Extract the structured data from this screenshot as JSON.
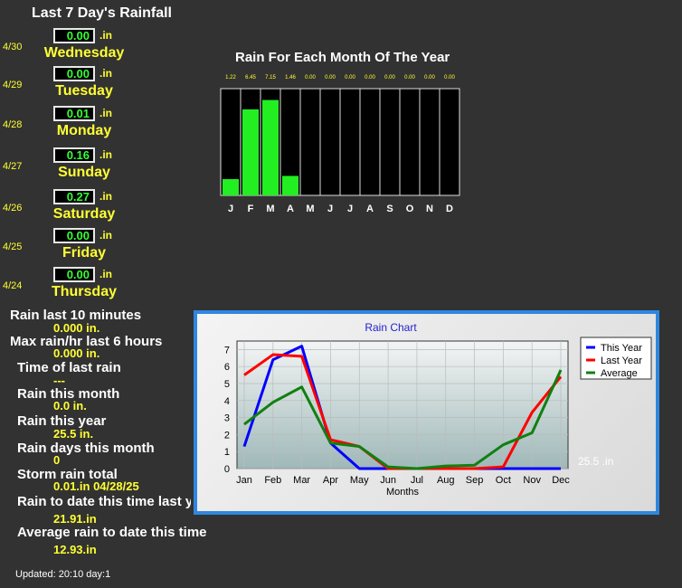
{
  "last7": {
    "title": "Last 7 Day's Rainfall",
    "unit": ".in",
    "days": [
      {
        "date": "4/30",
        "value": "0.00",
        "day": "Wednesday"
      },
      {
        "date": "4/29",
        "value": "0.00",
        "day": "Tuesday"
      },
      {
        "date": "4/28",
        "value": "0.01",
        "day": "Monday"
      },
      {
        "date": "4/27",
        "value": "0.16",
        "day": "Sunday"
      },
      {
        "date": "4/26",
        "value": "0.27",
        "day": "Saturday"
      },
      {
        "date": "4/25",
        "value": "0.00",
        "day": "Friday"
      },
      {
        "date": "4/24",
        "value": "0.00",
        "day": "Thursday"
      }
    ]
  },
  "stats": [
    {
      "label": "Rain last 10 minutes",
      "value": "0.000 in."
    },
    {
      "label": "Max rain/hr last 6 hours",
      "value": "0.000 in."
    },
    {
      "label": "Time of last rain",
      "value": "---"
    },
    {
      "label": "Rain this month",
      "value": "0.0 in."
    },
    {
      "label": "Rain this year",
      "value": "25.5 in."
    },
    {
      "label": "Rain days this month",
      "value": "0"
    },
    {
      "label": "Storm rain total",
      "value": "0.01.in 04/28/25"
    },
    {
      "label": "Rain to date this time last year",
      "value": "21.91.in"
    },
    {
      "label": "Average rain to date this time",
      "value": "12.93.in"
    }
  ],
  "updated": "Updated: 20:10 day:1",
  "year_total": "25.5 .in",
  "colors": {
    "bar_fill": "#22ee22",
    "this_year": "#0000ff",
    "last_year": "#ff0000",
    "average": "#108010",
    "accent_border": "#2f86e0"
  },
  "chart_data": [
    {
      "type": "bar",
      "title": "Rain For Each Month Of The Year",
      "categories": [
        "J",
        "F",
        "M",
        "A",
        "M",
        "J",
        "J",
        "A",
        "S",
        "O",
        "N",
        "D"
      ],
      "value_labels": [
        "1.22",
        "6.45",
        "7.15",
        "1.46",
        "0.00",
        "0.00",
        "0.00",
        "0.00",
        "0.00",
        "0.00",
        "0.00",
        "0.00"
      ],
      "values": [
        1.22,
        6.45,
        7.15,
        1.46,
        0,
        0,
        0,
        0,
        0,
        0,
        0,
        0
      ],
      "ylim": [
        0,
        8
      ]
    },
    {
      "type": "line",
      "title": "Rain Chart",
      "xlabel": "Months",
      "ylabel": "",
      "categories": [
        "Jan",
        "Feb",
        "Mar",
        "Apr",
        "May",
        "Jun",
        "Jul",
        "Aug",
        "Sep",
        "Oct",
        "Nov",
        "Dec"
      ],
      "ylim": [
        0,
        7.5
      ],
      "yticks": [
        0,
        1,
        2,
        3,
        4,
        5,
        6,
        7
      ],
      "grid": true,
      "legend": "top-right",
      "series": [
        {
          "name": "This Year",
          "color": "#0000ff",
          "values": [
            1.3,
            6.4,
            7.2,
            1.5,
            0,
            0,
            0,
            0,
            0,
            0,
            0,
            0
          ]
        },
        {
          "name": "Last Year",
          "color": "#ff0000",
          "values": [
            5.5,
            6.7,
            6.6,
            1.7,
            1.3,
            0,
            0,
            0,
            0,
            0.1,
            3.3,
            5.4
          ]
        },
        {
          "name": "Average",
          "color": "#108010",
          "values": [
            2.6,
            3.9,
            4.8,
            1.5,
            1.3,
            0.1,
            0,
            0.15,
            0.2,
            1.4,
            2.1,
            5.8
          ]
        }
      ]
    }
  ]
}
